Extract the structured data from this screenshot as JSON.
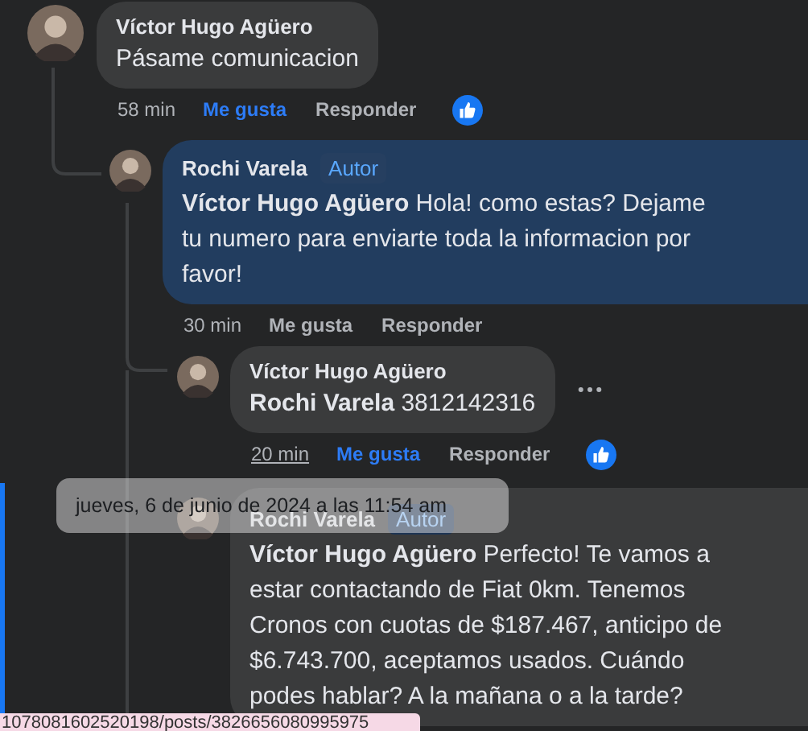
{
  "comments": [
    {
      "author": "Víctor Hugo Agüero",
      "text": "Pásame comunicacion",
      "time": "58 min",
      "like_label": "Me gusta",
      "liked": true,
      "reply_label": "Responder",
      "reaction_shown": true,
      "children": [
        {
          "author": "Rochi Varela",
          "badge": "Autor",
          "mention": "Víctor Hugo Agüero",
          "text": "Hola! como estas? Dejame tu numero para enviarte toda la informacion por favor!",
          "time": "30 min",
          "like_label": "Me gusta",
          "liked": false,
          "reply_label": "Responder",
          "highlighted": true,
          "children": [
            {
              "author": "Víctor Hugo Agüero",
              "mention": "Rochi Varela",
              "text": "3812142316",
              "time": "20 min",
              "time_hovered": true,
              "like_label": "Me gusta",
              "liked": true,
              "reply_label": "Responder",
              "reaction_shown": true,
              "more_menu": true
            },
            {
              "author": "Rochi Varela",
              "badge": "Autor",
              "mention": "Víctor Hugo Agüero",
              "text": "Perfecto! Te vamos a estar contactando de Fiat 0km. Tenemos Cronos con cuotas de $187.467, anticipo de $6.743.700, aceptamos usados. Cuándo podes hablar? A la mañana o a la tarde?"
            }
          ]
        }
      ]
    }
  ],
  "tooltip": {
    "text": "jueves, 6 de junio de 2024 a las 11:54 am"
  },
  "status_url": "1078081602520198/posts/3826656080995975"
}
